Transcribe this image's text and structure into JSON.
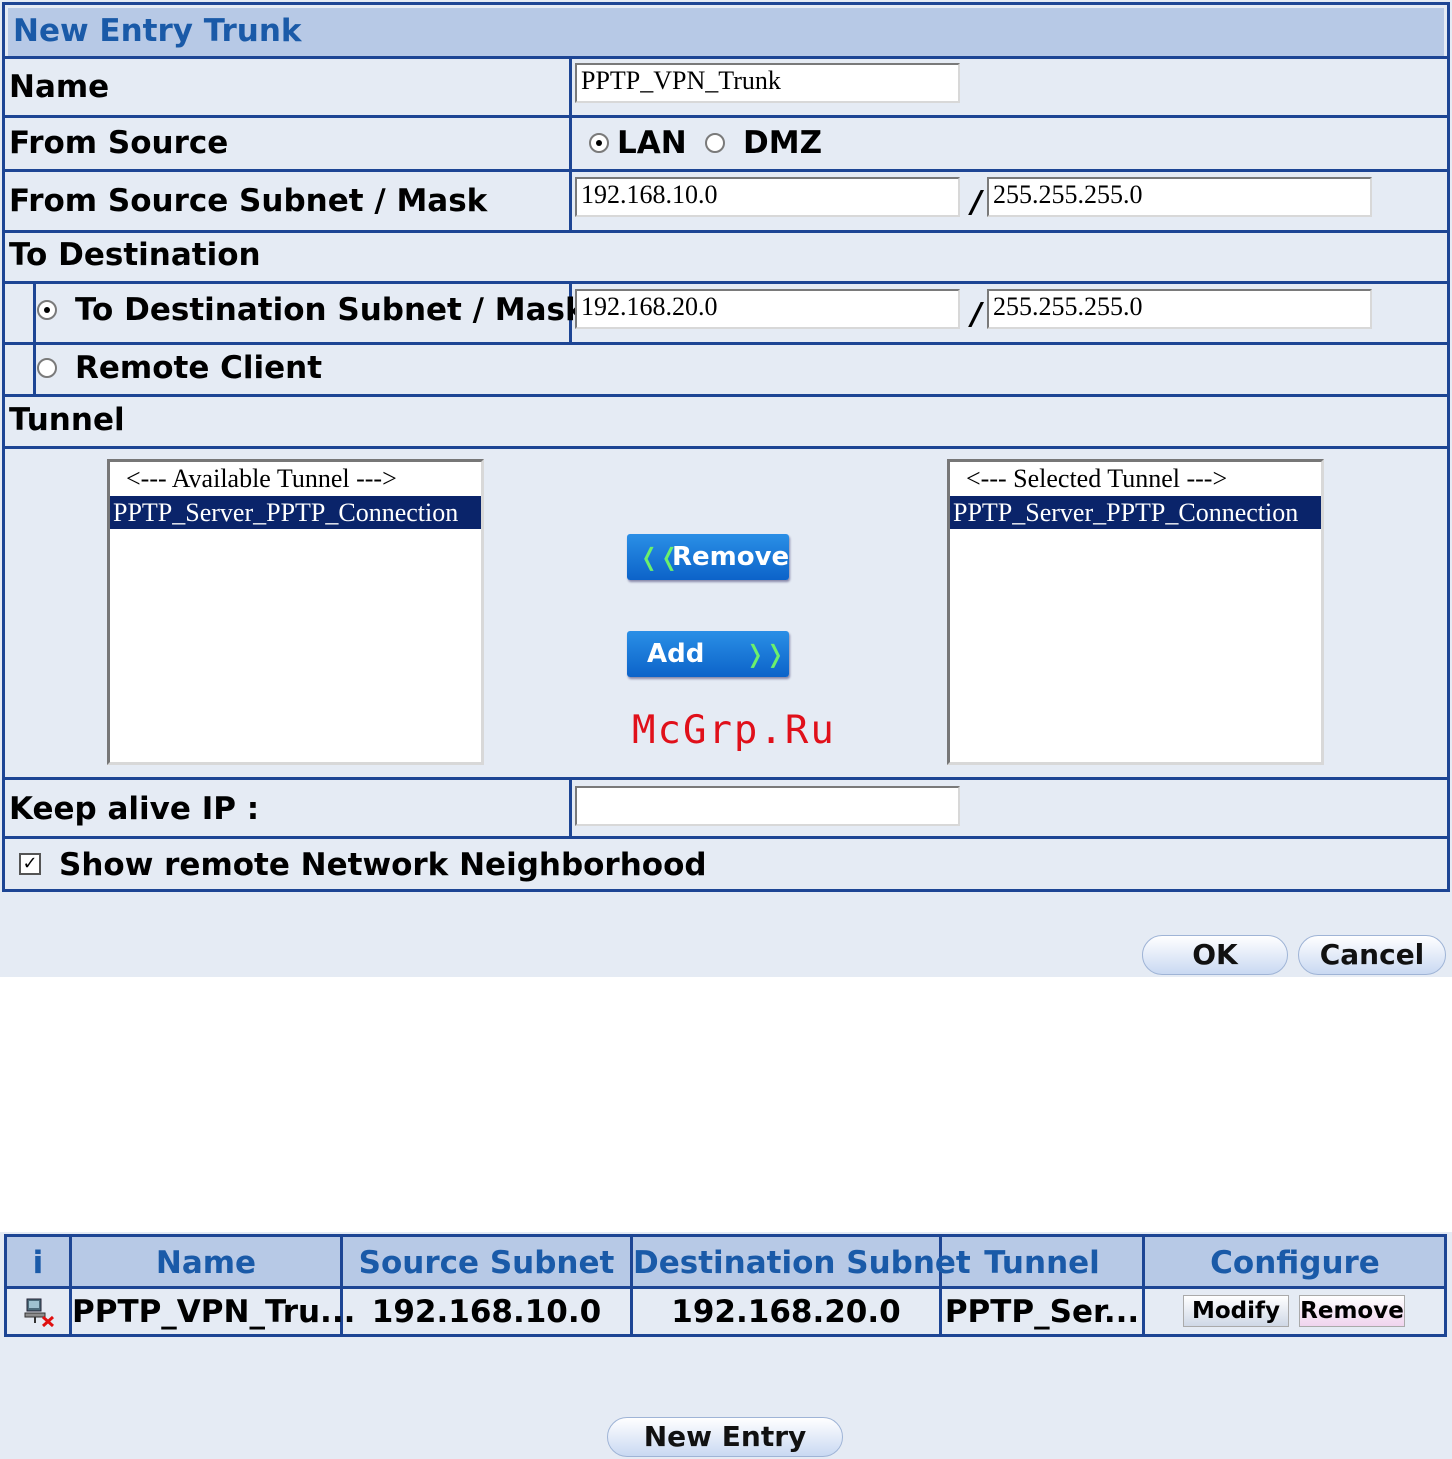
{
  "form": {
    "title": "New Entry Trunk",
    "name_label": "Name",
    "name_value": "PPTP_VPN_Trunk",
    "from_source_label": "From Source",
    "from_source_options": [
      "LAN",
      "DMZ"
    ],
    "from_source_selected": "LAN",
    "from_subnet_label": "From Source Subnet / Mask",
    "from_subnet_value": "192.168.10.0",
    "from_mask_value": "255.255.255.0",
    "to_destination_label": "To Destination",
    "to_subnet_label": "To Destination Subnet / Mask",
    "to_subnet_value": "192.168.20.0",
    "to_mask_value": "255.255.255.0",
    "remote_client_label": "Remote Client",
    "slash": "/",
    "tunnel_label": "Tunnel",
    "available_header": "<--- Available Tunnel --->",
    "available_items": [
      "PPTP_Server_PPTP_Connection"
    ],
    "selected_header": "<--- Selected Tunnel --->",
    "selected_items": [
      "PPTP_Server_PPTP_Connection"
    ],
    "remove_label": "Remove",
    "add_label": "Add",
    "keep_alive_label": "Keep alive IP :",
    "keep_alive_value": "",
    "show_neighborhood_label": "Show remote Network Neighborhood",
    "show_neighborhood_checked": true,
    "ok_label": "OK",
    "cancel_label": "Cancel"
  },
  "watermark": "McGrp.Ru",
  "list": {
    "headers": [
      "i",
      "Name",
      "Source Subnet",
      "Destination Subnet",
      "Tunnel",
      "Configure"
    ],
    "row": {
      "icon": "network-computer-disconnected-icon",
      "name": "PPTP_VPN_Tru...",
      "source": "192.168.10.0",
      "destination": "192.168.20.0",
      "tunnel": "PPTP_Ser...",
      "modify": "Modify",
      "remove": "Remove"
    },
    "new_entry_label": "New Entry"
  }
}
